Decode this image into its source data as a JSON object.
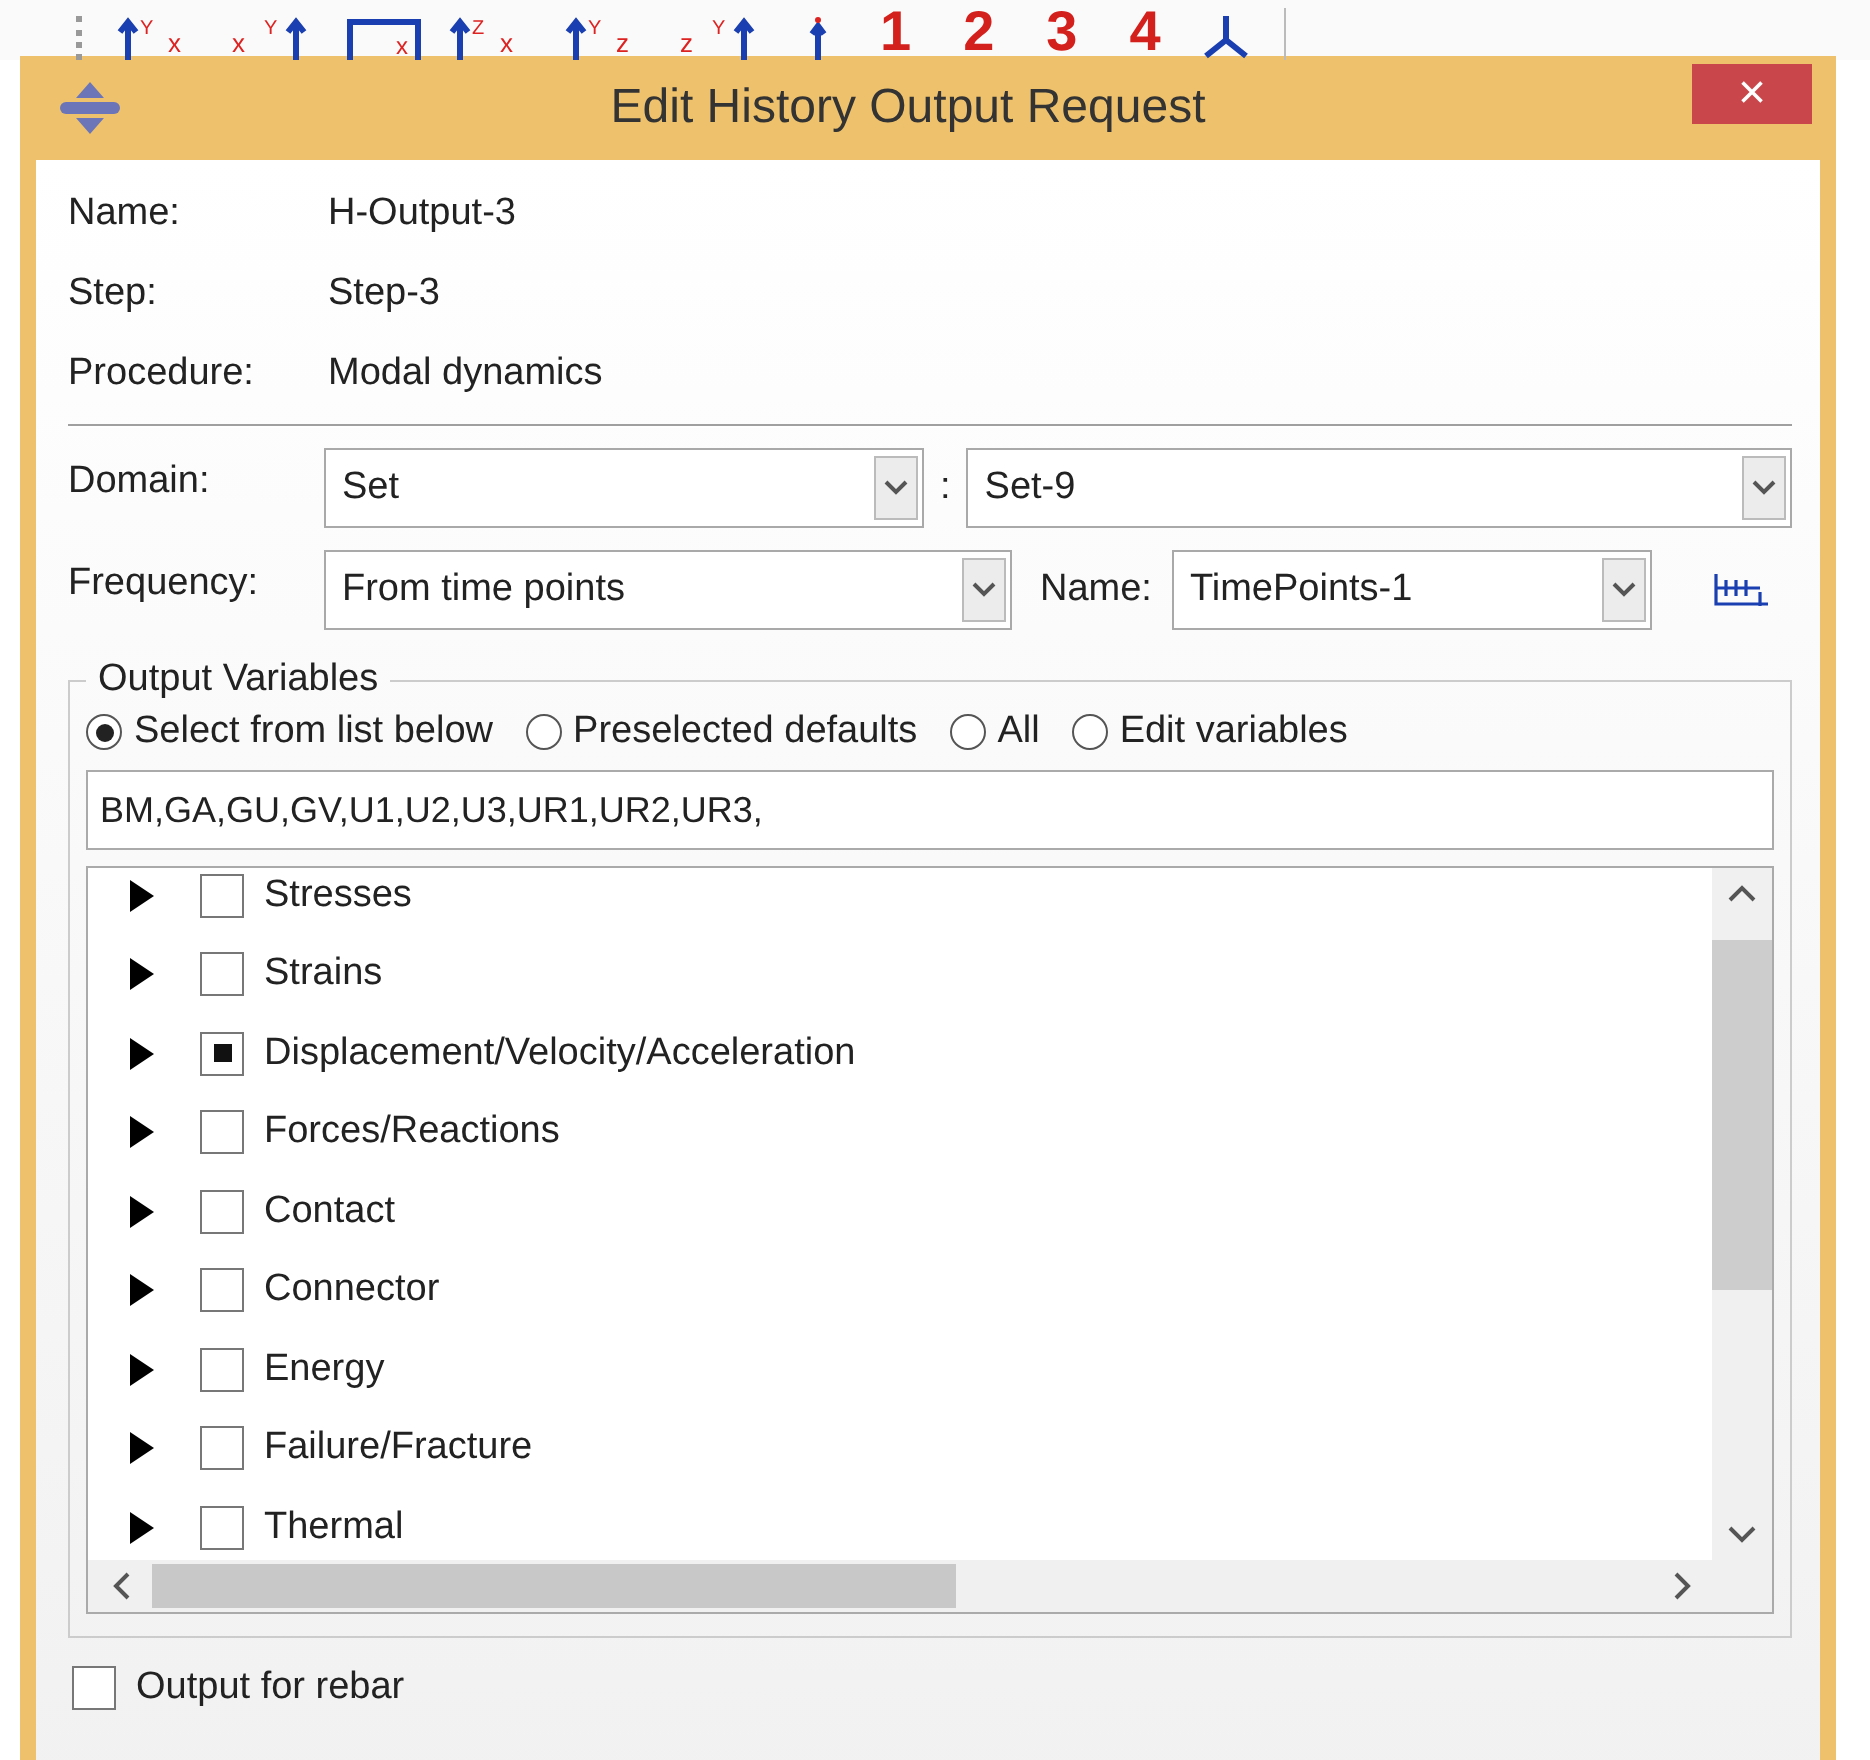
{
  "toolbar": {
    "items": [
      {
        "kind": "axis",
        "up": "Y",
        "right": "x"
      },
      {
        "kind": "axis-rev",
        "up": "Y",
        "right": "x"
      },
      {
        "kind": "box",
        "right": "x"
      },
      {
        "kind": "axis",
        "up": "Z",
        "right": "x"
      },
      {
        "kind": "axis",
        "up": "Y",
        "right": "z"
      },
      {
        "kind": "axis-rev",
        "up": "Y",
        "right": "z"
      },
      {
        "kind": "pin"
      },
      {
        "kind": "number",
        "label": "1"
      },
      {
        "kind": "number",
        "label": "2"
      },
      {
        "kind": "number",
        "label": "3"
      },
      {
        "kind": "number",
        "label": "4"
      },
      {
        "kind": "triad"
      }
    ]
  },
  "window": {
    "title": "Edit History Output Request",
    "close": "×"
  },
  "info": [
    {
      "label": "Name:",
      "value": "H-Output-3"
    },
    {
      "label": "Step:",
      "value": "Step-3"
    },
    {
      "label": "Procedure:",
      "value": "Modal dynamics"
    }
  ],
  "domain": {
    "label": "Domain:",
    "value": "Set",
    "separator": ":",
    "set": "Set-9"
  },
  "frequency": {
    "label": "Frequency:",
    "value": "From time points",
    "name_label": "Name:",
    "name_value": "TimePoints-1"
  },
  "output_variables": {
    "title": "Output Variables",
    "options": [
      {
        "label": "Select from list below",
        "selected": true
      },
      {
        "label": "Preselected defaults",
        "selected": false
      },
      {
        "label": "All",
        "selected": false
      },
      {
        "label": "Edit variables",
        "selected": false
      }
    ],
    "variables_text": "BM,GA,GU,GV,U1,U2,U3,UR1,UR2,UR3,",
    "items": [
      {
        "label": "Stresses",
        "checked": false
      },
      {
        "label": "Strains",
        "checked": false
      },
      {
        "label": "Displacement/Velocity/Acceleration",
        "checked": true
      },
      {
        "label": "Forces/Reactions",
        "checked": false
      },
      {
        "label": "Contact",
        "checked": false
      },
      {
        "label": "Connector",
        "checked": false
      },
      {
        "label": "Energy",
        "checked": false
      },
      {
        "label": "Failure/Fracture",
        "checked": false
      },
      {
        "label": "Thermal",
        "checked": false
      }
    ]
  },
  "rebar": {
    "label": "Output for rebar",
    "checked": false
  }
}
